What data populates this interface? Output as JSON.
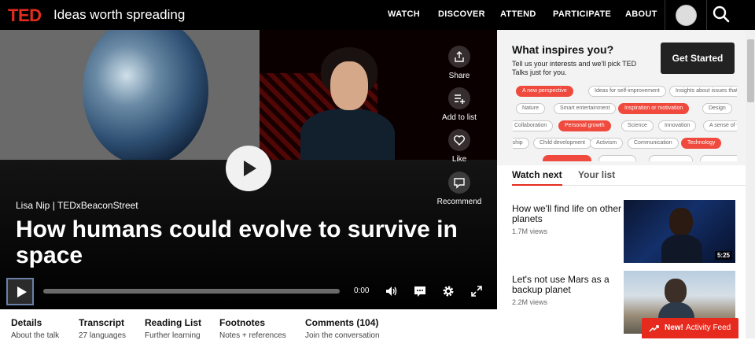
{
  "header": {
    "logo": "TED",
    "tagline": "Ideas worth spreading",
    "nav": [
      "WATCH",
      "DISCOVER",
      "ATTEND",
      "PARTICIPATE",
      "ABOUT"
    ]
  },
  "video": {
    "speaker_event": "Lisa Nip | TEDxBeaconStreet",
    "title": "How humans could evolve to survive in space",
    "time": "0:00",
    "actions": {
      "share": "Share",
      "add_to_list": "Add to list",
      "like": "Like",
      "recommend": "Recommend"
    }
  },
  "tabs": [
    {
      "title": "Details",
      "sub": "About the talk"
    },
    {
      "title": "Transcript",
      "sub": "27 languages"
    },
    {
      "title": "Reading List",
      "sub": "Further learning"
    },
    {
      "title": "Footnotes",
      "sub": "Notes + references"
    },
    {
      "title": "Comments (104)",
      "sub": "Join the conversation"
    }
  ],
  "inspire": {
    "title": "What inspires you?",
    "subtitle": "Tell us your interests and we'll pick TED Talks just for you.",
    "button": "Get Started",
    "chips": [
      {
        "label": "A new perspective",
        "selected": true
      },
      {
        "label": "Ideas for self-improvement",
        "selected": false
      },
      {
        "label": "Insights about issues that",
        "selected": false
      },
      {
        "label": "Nature",
        "selected": false
      },
      {
        "label": "Smart entertainment",
        "selected": false
      },
      {
        "label": "Inspiration or motivation",
        "selected": true
      },
      {
        "label": "Design",
        "selected": false
      },
      {
        "label": "Collaboration",
        "selected": false
      },
      {
        "label": "Personal growth",
        "selected": true
      },
      {
        "label": "Science",
        "selected": false
      },
      {
        "label": "Innovation",
        "selected": false
      },
      {
        "label": "A sense of wonder",
        "selected": false
      },
      {
        "label": "Leadership",
        "selected": false
      },
      {
        "label": "Child development",
        "selected": false
      },
      {
        "label": "Activism",
        "selected": false
      },
      {
        "label": "Communication",
        "selected": false
      },
      {
        "label": "Technology",
        "selected": true
      }
    ]
  },
  "watch_next": {
    "tab_active": "Watch next",
    "tab_other": "Your list",
    "items": [
      {
        "title": "How we'll find life on other planets",
        "views": "1.7M views",
        "duration": "5:25"
      },
      {
        "title": "Let's not use Mars as a backup planet",
        "views": "2.2M views",
        "duration": ""
      }
    ]
  },
  "activity_feed": {
    "new_label": "New!",
    "label": "Activity Feed"
  },
  "colors": {
    "ted_red": "#e62b1e",
    "chip_red": "#ef4a3d"
  }
}
